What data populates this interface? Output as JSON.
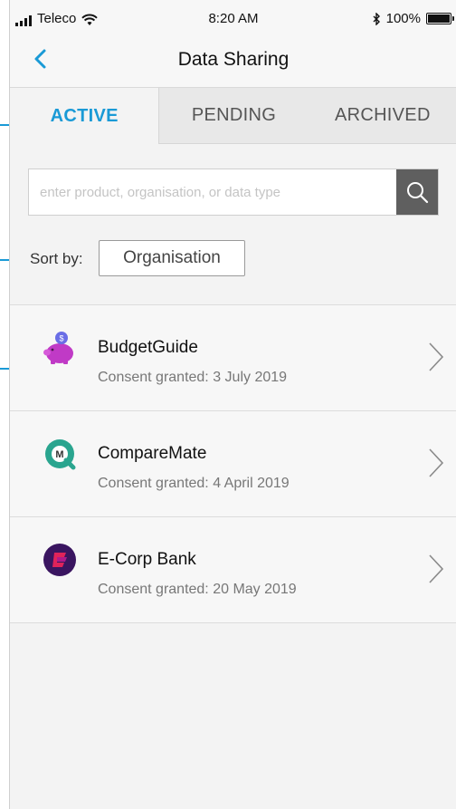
{
  "status_bar": {
    "carrier": "Teleco",
    "time": "8:20 AM",
    "battery": "100%"
  },
  "nav": {
    "title": "Data Sharing"
  },
  "tabs": [
    {
      "label": "ACTIVE",
      "active": true
    },
    {
      "label": "PENDING",
      "active": false
    },
    {
      "label": "ARCHIVED",
      "active": false
    }
  ],
  "search": {
    "placeholder": "enter product, organisation, or data type",
    "value": ""
  },
  "sort": {
    "label": "Sort by:",
    "value": "Organisation"
  },
  "items": [
    {
      "name": "BudgetGuide",
      "consent": "Consent granted: 3 July 2019",
      "logo": "piggy-bank-icon"
    },
    {
      "name": "CompareMate",
      "consent": "Consent granted: 4 April 2019",
      "logo": "comparemate-logo-icon"
    },
    {
      "name": "E-Corp Bank",
      "consent": "Consent granted: 20 May 2019",
      "logo": "ecorp-logo-icon"
    }
  ],
  "colors": {
    "accent": "#1a9ad6",
    "search_button": "#5f5f5f"
  }
}
